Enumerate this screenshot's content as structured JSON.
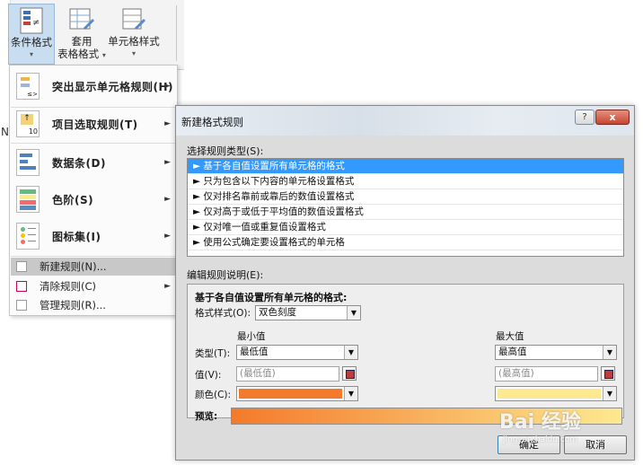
{
  "ribbon": {
    "conditional_format": "条件格式",
    "table_format_line1": "套用",
    "table_format_line2": "表格格式",
    "cell_style": "单元格样式",
    "caret": "▾"
  },
  "menu": {
    "highlight_rules": "突出显示单元格规则(H)",
    "top_bottom_rules": "项目选取规则(T)",
    "data_bars": "数据条(D)",
    "color_scales": "色阶(S)",
    "icon_sets": "图标集(I)",
    "new_rule": "新建规则(N)...",
    "clear_rules": "清除规则(C)",
    "manage_rules": "管理规则(R)...",
    "arrow": "►"
  },
  "grid": {
    "col_letter": "N"
  },
  "dialog": {
    "title": "新建格式规则",
    "help": "?",
    "close": "x",
    "select_type_label": "选择规则类型(S):",
    "rules": [
      "► 基于各自值设置所有单元格的格式",
      "► 只为包含以下内容的单元格设置格式",
      "► 仅对排名靠前或靠后的数值设置格式",
      "► 仅对高于或低于平均值的数值设置格式",
      "► 仅对唯一值或重复值设置格式",
      "► 使用公式确定要设置格式的单元格"
    ],
    "edit_desc_label": "编辑规则说明(E):",
    "desc_title": "基于各自值设置所有单元格的格式:",
    "format_style_label": "格式样式(O):",
    "format_style_value": "双色刻度",
    "min_header": "最小值",
    "max_header": "最大值",
    "type_label": "类型(T):",
    "value_label": "值(V):",
    "color_label": "颜色(C):",
    "min_type": "最低值",
    "max_type": "最高值",
    "min_value": "(最低值)",
    "max_value": "(最高值)",
    "preview_label": "预览:",
    "ok": "确定",
    "cancel": "取消",
    "min_color": "#f47a2b",
    "max_color": "#fde990"
  },
  "watermark": {
    "text": "Bai 经验",
    "sub": "jingyan.baidu.com"
  }
}
